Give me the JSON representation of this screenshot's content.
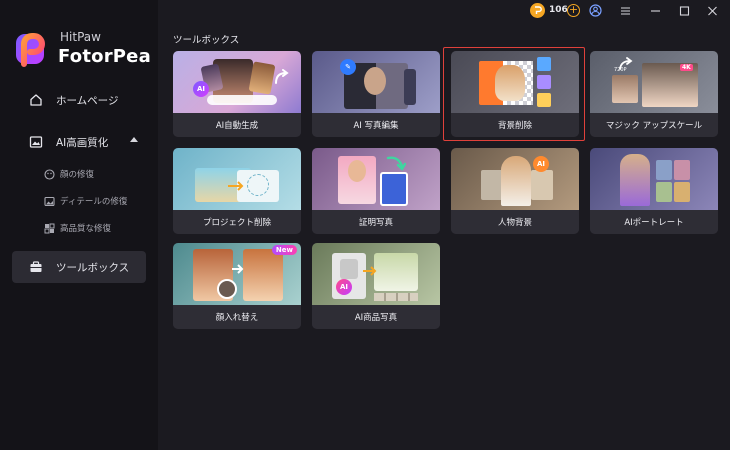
{
  "brand": {
    "small": "HitPaw",
    "big": "FotorPea"
  },
  "topbar": {
    "coins": "106"
  },
  "sidebar": {
    "items": [
      {
        "label": "ホームページ"
      },
      {
        "label": "AI高画質化"
      },
      {
        "label": "ツールボックス"
      }
    ],
    "subitems": [
      {
        "label": "顔の修復"
      },
      {
        "label": "ディテールの修復"
      },
      {
        "label": "高品質な修復"
      }
    ]
  },
  "main": {
    "title": "ツールボックス",
    "cards": [
      {
        "label": "AI自動生成"
      },
      {
        "label": "AI 写真編集"
      },
      {
        "label": "背景削除"
      },
      {
        "label": "マジック アップスケール"
      },
      {
        "label": "プロジェクト削除"
      },
      {
        "label": "証明写真"
      },
      {
        "label": "人物背景"
      },
      {
        "label": "AIポートレート"
      },
      {
        "label": "顔入れ替え"
      },
      {
        "label": "AI商品写真"
      }
    ],
    "badges": {
      "new": "New",
      "ai": "AI",
      "k4": "4K",
      "res": "720P"
    }
  },
  "colors": {
    "accent": "#f5a623",
    "selection": "#e0413b",
    "sidebar_bg": "#141318",
    "main_bg": "#1b1a20"
  }
}
